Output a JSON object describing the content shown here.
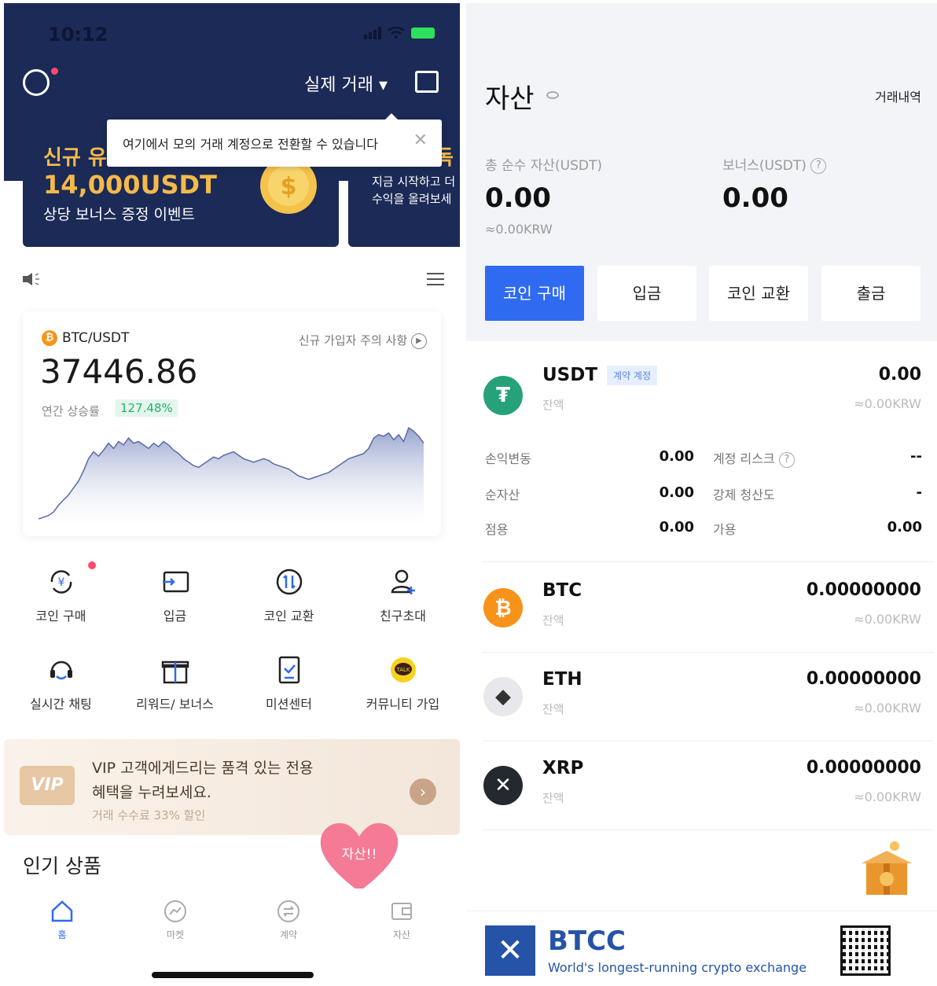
{
  "left": {
    "status": {
      "time": "10:12"
    },
    "header": {
      "account_mode": "실제 거래 ▾"
    },
    "tooltip": {
      "text": "여기에서 모의 거래 계정으로 전환할 수 있습니다",
      "close": "✕"
    },
    "banner1": {
      "title": "신규 유",
      "amount": "14,000USDT",
      "subtitle": "상당 보너스 증정 이벤트"
    },
    "banner2": {
      "title": "독",
      "line1": "지금 시작하고 더",
      "line2": "수익을 올려보세"
    },
    "market_card": {
      "pair": "BTC/USDT",
      "coin_glyph": "₿",
      "notice_link": "신규 가입자 주의 사항",
      "price": "37446.86",
      "annual_label": "연간 상승률",
      "annual_value": "127.48%",
      "sparkline": [
        2,
        4,
        6,
        10,
        18,
        24,
        30,
        38,
        46,
        58,
        72,
        80,
        75,
        82,
        90,
        84,
        92,
        88,
        96,
        90,
        92,
        88,
        84,
        90,
        86,
        92,
        88,
        82,
        78,
        72,
        68,
        64,
        62,
        66,
        70,
        74,
        72,
        76,
        78,
        80,
        76,
        72,
        70,
        68,
        70,
        72,
        70,
        66,
        64,
        62,
        60,
        56,
        52,
        50,
        48,
        50,
        52,
        54,
        56,
        60,
        64,
        68,
        72,
        74,
        76,
        78,
        84,
        96,
        100,
        98,
        102,
        94,
        100,
        92,
        108,
        104,
        98,
        90
      ]
    },
    "actions": [
      {
        "label": "코인 구매",
        "icon": "coin-swap-icon",
        "badge": true
      },
      {
        "label": "입금",
        "icon": "deposit-icon"
      },
      {
        "label": "코인 교환",
        "icon": "exchange-icon"
      },
      {
        "label": "친구초대",
        "icon": "invite-friend-icon"
      },
      {
        "label": "실시간 채팅",
        "icon": "headset-icon"
      },
      {
        "label": "리워드/ 보너스",
        "icon": "gift-icon"
      },
      {
        "label": "미션센터",
        "icon": "mission-icon"
      },
      {
        "label": "커뮤니티 가입",
        "icon": "talk-icon"
      }
    ],
    "vip": {
      "badge": "VIP",
      "line1": "VIP 고객에게드리는 품격 있는 전용",
      "line2": "혜택을 누려보세요.",
      "sub": "거래 수수료 33% 할인"
    },
    "popular": "인기 상품",
    "heart_text": "자산!!",
    "tabs": [
      {
        "label": "홈",
        "icon": "home-icon",
        "active": true
      },
      {
        "label": "마켓",
        "icon": "market-icon"
      },
      {
        "label": "계약",
        "icon": "contract-icon"
      },
      {
        "label": "자산",
        "icon": "wallet-icon"
      }
    ]
  },
  "right": {
    "title": "자산",
    "history": "거래내역",
    "total_label": "총 순수 자산(USDT)",
    "total_value": "0.00",
    "total_krw": "≈0.00KRW",
    "bonus_label": "보너스(USDT)",
    "bonus_value": "0.00",
    "buttons": [
      "코인 구매",
      "입금",
      "코인 교환",
      "출금"
    ],
    "usdt": {
      "name": "USDT",
      "tag": "계약 계정",
      "sub": "잔액",
      "value": "0.00",
      "krw": "≈0.00KRW",
      "details": [
        {
          "k1": "손익변동",
          "v1": "0.00",
          "k2": "계정 리스크",
          "v2": "--"
        },
        {
          "k1": "순자산",
          "v1": "0.00",
          "k2": "강제 청산도",
          "v2": "-"
        },
        {
          "k1": "점용",
          "v1": "0.00",
          "k2": "가용",
          "v2": "0.00"
        }
      ]
    },
    "coins": [
      {
        "name": "BTC",
        "sub": "잔액",
        "value": "0.00000000",
        "krw": "≈0.00KRW",
        "color": "#f7931a",
        "glyph": "₿"
      },
      {
        "name": "ETH",
        "sub": "잔액",
        "value": "0.00000000",
        "krw": "≈0.00KRW",
        "color": "#e8e8ec",
        "glyph": "◆"
      },
      {
        "name": "XRP",
        "sub": "잔액",
        "value": "0.00000000",
        "krw": "≈0.00KRW",
        "color": "#23292f",
        "glyph": "✕"
      }
    ],
    "footer": {
      "logo": "✕",
      "brand": "BTCC",
      "slogan": "World's longest-running crypto exchange"
    }
  }
}
